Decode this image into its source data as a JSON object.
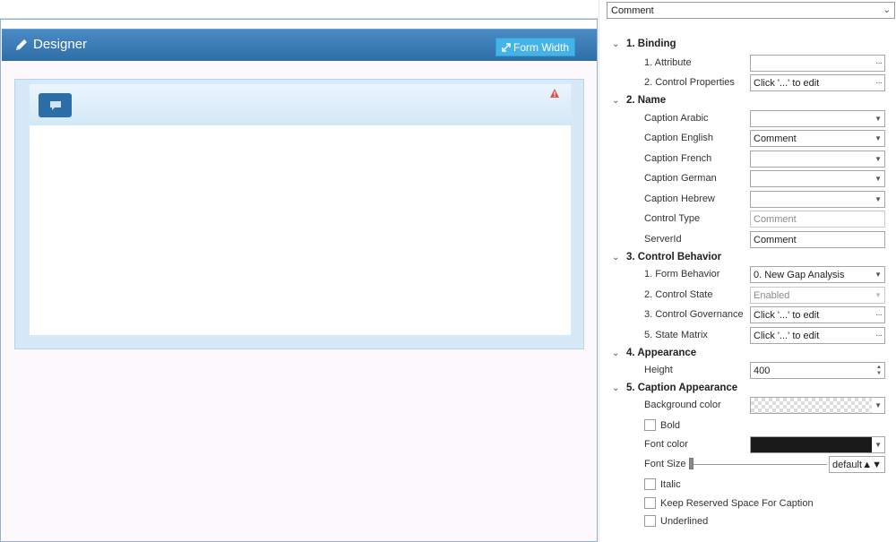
{
  "designer": {
    "title": "Designer",
    "form_width_label": "Form Width"
  },
  "properties": {
    "object_selector": "Comment",
    "sections": [
      {
        "label": "1. Binding"
      },
      {
        "label": "2. Name"
      },
      {
        "label": "3. Control Behavior"
      },
      {
        "label": "4. Appearance"
      },
      {
        "label": "5. Caption Appearance"
      }
    ],
    "binding": {
      "attribute_label": "1. Attribute",
      "attribute_value": "",
      "control_props_label": "2. Control Properties",
      "control_props_value": "Click '...' to edit"
    },
    "name": {
      "caption_arabic_label": "Caption Arabic",
      "caption_arabic_value": "",
      "caption_english_label": "Caption English",
      "caption_english_value": "Comment",
      "caption_french_label": "Caption French",
      "caption_french_value": "",
      "caption_german_label": "Caption German",
      "caption_german_value": "",
      "caption_hebrew_label": "Caption Hebrew",
      "caption_hebrew_value": "",
      "control_type_label": "Control Type",
      "control_type_value": "Comment",
      "server_id_label": "ServerId",
      "server_id_value": "Comment"
    },
    "behavior": {
      "form_behavior_label": "1. Form Behavior",
      "form_behavior_value": "0. New Gap Analysis",
      "control_state_label": "2. Control State",
      "control_state_value": "Enabled",
      "governance_label": "3. Control Governance",
      "governance_value": "Click '...' to edit",
      "state_matrix_label": "5. State Matrix",
      "state_matrix_value": "Click '...' to edit"
    },
    "appearance": {
      "height_label": "Height",
      "height_value": "400"
    },
    "caption_appearance": {
      "bg_color_label": "Background color",
      "bold_label": "Bold",
      "font_color_label": "Font color",
      "font_color_hex": "#1a1a1a",
      "font_size_label": "Font Size",
      "font_size_value": "default",
      "italic_label": "Italic",
      "reserved_space_label": "Keep Reserved Space For Caption",
      "underlined_label": "Underlined"
    },
    "ellipsis": "···"
  },
  "colors": {
    "header_blue": "#2e6ea7",
    "button_cyan": "#45b3e6",
    "frame_blue": "#d7e9f7",
    "warning_red": "#d9534f"
  }
}
